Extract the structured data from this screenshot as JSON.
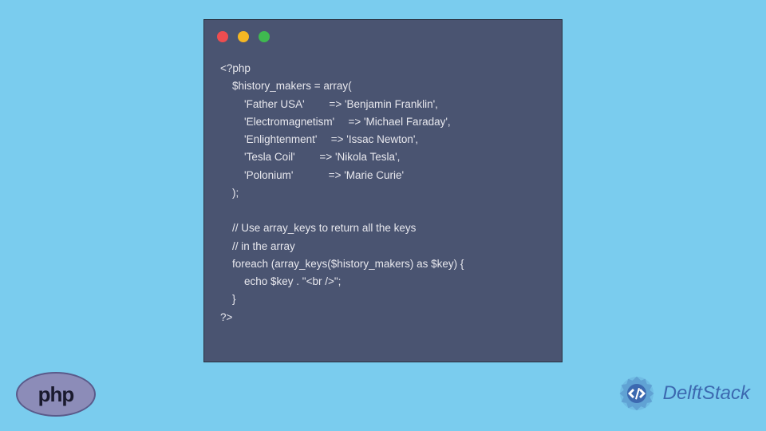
{
  "colors": {
    "background": "#7accee",
    "window_bg": "#4a5471",
    "code_text": "#e8e8ee",
    "dot_red": "#ee4d50",
    "dot_yellow": "#f5b723",
    "dot_green": "#3fb950",
    "php_bg": "#8c8cb8",
    "delft_blue": "#3c69b0"
  },
  "code": {
    "line1": "<?php",
    "line2": "    $history_makers = array(",
    "line3": "        'Father USA'   => 'Benjamin Franklin',",
    "line4": "        'Electromagnetism'  => 'Michael Faraday',",
    "line5": "        'Enlightenment'  => 'Issac Newton',",
    "line6": "        'Tesla Coil'   => 'Nikola Tesla',",
    "line7": "        'Polonium'    => 'Marie Curie'",
    "line8": "    );",
    "line9": "",
    "line10": "    // Use array_keys to return all the keys",
    "line11": "    // in the array",
    "line12": "    foreach (array_keys($history_makers) as $key) {",
    "line13": "        echo $key . \"<br />\";",
    "line14": "    }",
    "line15": "?>"
  },
  "logos": {
    "php": "php",
    "delft": "DelftStack"
  }
}
